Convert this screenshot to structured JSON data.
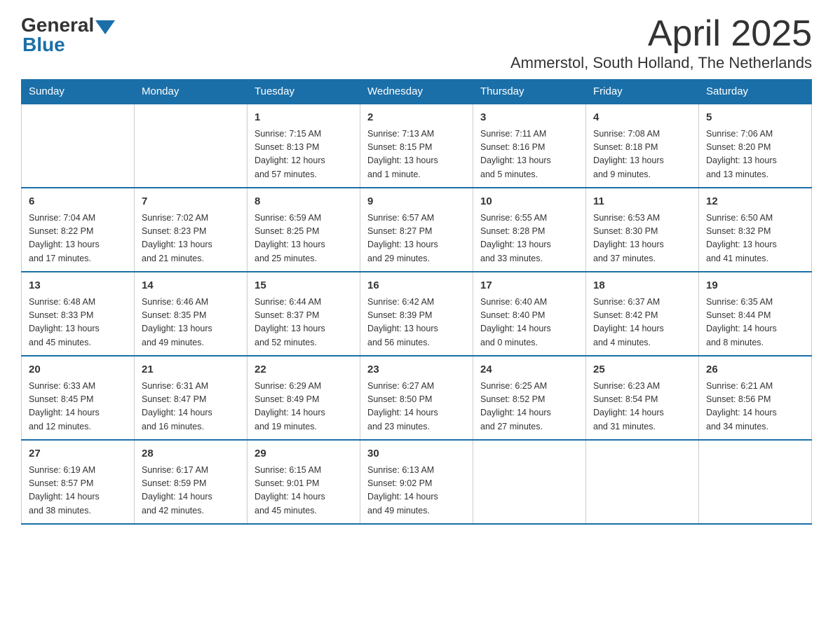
{
  "header": {
    "logo_general": "General",
    "logo_blue": "Blue",
    "month_title": "April 2025",
    "location": "Ammerstol, South Holland, The Netherlands"
  },
  "days_of_week": [
    "Sunday",
    "Monday",
    "Tuesday",
    "Wednesday",
    "Thursday",
    "Friday",
    "Saturday"
  ],
  "weeks": [
    [
      {
        "day": "",
        "info": ""
      },
      {
        "day": "",
        "info": ""
      },
      {
        "day": "1",
        "info": "Sunrise: 7:15 AM\nSunset: 8:13 PM\nDaylight: 12 hours\nand 57 minutes."
      },
      {
        "day": "2",
        "info": "Sunrise: 7:13 AM\nSunset: 8:15 PM\nDaylight: 13 hours\nand 1 minute."
      },
      {
        "day": "3",
        "info": "Sunrise: 7:11 AM\nSunset: 8:16 PM\nDaylight: 13 hours\nand 5 minutes."
      },
      {
        "day": "4",
        "info": "Sunrise: 7:08 AM\nSunset: 8:18 PM\nDaylight: 13 hours\nand 9 minutes."
      },
      {
        "day": "5",
        "info": "Sunrise: 7:06 AM\nSunset: 8:20 PM\nDaylight: 13 hours\nand 13 minutes."
      }
    ],
    [
      {
        "day": "6",
        "info": "Sunrise: 7:04 AM\nSunset: 8:22 PM\nDaylight: 13 hours\nand 17 minutes."
      },
      {
        "day": "7",
        "info": "Sunrise: 7:02 AM\nSunset: 8:23 PM\nDaylight: 13 hours\nand 21 minutes."
      },
      {
        "day": "8",
        "info": "Sunrise: 6:59 AM\nSunset: 8:25 PM\nDaylight: 13 hours\nand 25 minutes."
      },
      {
        "day": "9",
        "info": "Sunrise: 6:57 AM\nSunset: 8:27 PM\nDaylight: 13 hours\nand 29 minutes."
      },
      {
        "day": "10",
        "info": "Sunrise: 6:55 AM\nSunset: 8:28 PM\nDaylight: 13 hours\nand 33 minutes."
      },
      {
        "day": "11",
        "info": "Sunrise: 6:53 AM\nSunset: 8:30 PM\nDaylight: 13 hours\nand 37 minutes."
      },
      {
        "day": "12",
        "info": "Sunrise: 6:50 AM\nSunset: 8:32 PM\nDaylight: 13 hours\nand 41 minutes."
      }
    ],
    [
      {
        "day": "13",
        "info": "Sunrise: 6:48 AM\nSunset: 8:33 PM\nDaylight: 13 hours\nand 45 minutes."
      },
      {
        "day": "14",
        "info": "Sunrise: 6:46 AM\nSunset: 8:35 PM\nDaylight: 13 hours\nand 49 minutes."
      },
      {
        "day": "15",
        "info": "Sunrise: 6:44 AM\nSunset: 8:37 PM\nDaylight: 13 hours\nand 52 minutes."
      },
      {
        "day": "16",
        "info": "Sunrise: 6:42 AM\nSunset: 8:39 PM\nDaylight: 13 hours\nand 56 minutes."
      },
      {
        "day": "17",
        "info": "Sunrise: 6:40 AM\nSunset: 8:40 PM\nDaylight: 14 hours\nand 0 minutes."
      },
      {
        "day": "18",
        "info": "Sunrise: 6:37 AM\nSunset: 8:42 PM\nDaylight: 14 hours\nand 4 minutes."
      },
      {
        "day": "19",
        "info": "Sunrise: 6:35 AM\nSunset: 8:44 PM\nDaylight: 14 hours\nand 8 minutes."
      }
    ],
    [
      {
        "day": "20",
        "info": "Sunrise: 6:33 AM\nSunset: 8:45 PM\nDaylight: 14 hours\nand 12 minutes."
      },
      {
        "day": "21",
        "info": "Sunrise: 6:31 AM\nSunset: 8:47 PM\nDaylight: 14 hours\nand 16 minutes."
      },
      {
        "day": "22",
        "info": "Sunrise: 6:29 AM\nSunset: 8:49 PM\nDaylight: 14 hours\nand 19 minutes."
      },
      {
        "day": "23",
        "info": "Sunrise: 6:27 AM\nSunset: 8:50 PM\nDaylight: 14 hours\nand 23 minutes."
      },
      {
        "day": "24",
        "info": "Sunrise: 6:25 AM\nSunset: 8:52 PM\nDaylight: 14 hours\nand 27 minutes."
      },
      {
        "day": "25",
        "info": "Sunrise: 6:23 AM\nSunset: 8:54 PM\nDaylight: 14 hours\nand 31 minutes."
      },
      {
        "day": "26",
        "info": "Sunrise: 6:21 AM\nSunset: 8:56 PM\nDaylight: 14 hours\nand 34 minutes."
      }
    ],
    [
      {
        "day": "27",
        "info": "Sunrise: 6:19 AM\nSunset: 8:57 PM\nDaylight: 14 hours\nand 38 minutes."
      },
      {
        "day": "28",
        "info": "Sunrise: 6:17 AM\nSunset: 8:59 PM\nDaylight: 14 hours\nand 42 minutes."
      },
      {
        "day": "29",
        "info": "Sunrise: 6:15 AM\nSunset: 9:01 PM\nDaylight: 14 hours\nand 45 minutes."
      },
      {
        "day": "30",
        "info": "Sunrise: 6:13 AM\nSunset: 9:02 PM\nDaylight: 14 hours\nand 49 minutes."
      },
      {
        "day": "",
        "info": ""
      },
      {
        "day": "",
        "info": ""
      },
      {
        "day": "",
        "info": ""
      }
    ]
  ]
}
